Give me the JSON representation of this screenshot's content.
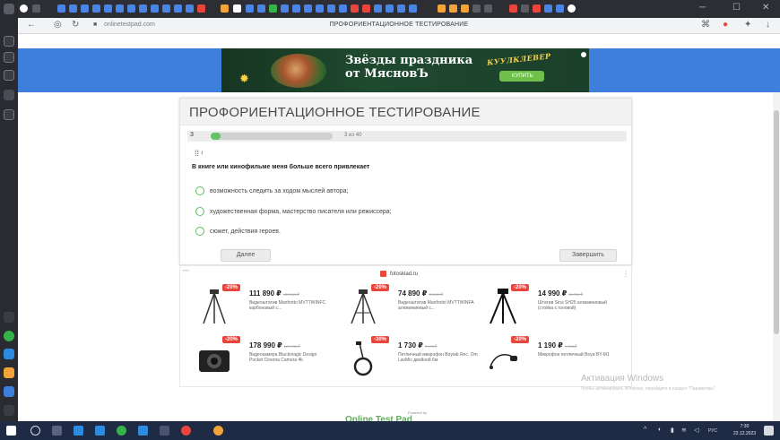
{
  "browser": {
    "url": "onlinetestpad.com",
    "tab_title": "ПРОФОРИЕНТАЦИОННОЕ ТЕСТИРОВАНИЕ",
    "window_controls": [
      "─",
      "☐",
      "✕"
    ]
  },
  "banner": {
    "headline_line1": "Звёзды праздника",
    "headline_line2": "от МясновЪ",
    "brand": "КУУЛКЛЕВЕР",
    "buy_label": "КУПИТЬ"
  },
  "test": {
    "title": "ПРОФОРИЕНТАЦИОННОЕ ТЕСТИРОВАНИЕ",
    "question_number": "3",
    "progress_fraction": 0.05,
    "progress_label": "3 из 40",
    "question": "В книге или кинофильме меня больше всего привлекает",
    "options": [
      "возможность следить за ходом мыслей автора;",
      "художественная форма, мастерство писателя или режиссера;",
      "сюжет, действия героев."
    ],
    "next_label": "Далее",
    "finish_label": "Завершить"
  },
  "ads": {
    "shop_name": "fotosklad.ru",
    "products": [
      {
        "discount": "-20%",
        "price": "111 890 ₽",
        "old_price": "139 863 ₽",
        "desc": "Видеоштатив Manfrotto MVTTWINFC карбоновый с..."
      },
      {
        "discount": "-20%",
        "price": "74 890 ₽",
        "old_price": "93 613 ₽",
        "desc": "Видеоштатив Manfrotto MVTTWINFA алюминиевый с..."
      },
      {
        "discount": "-20%",
        "price": "14 990 ₽",
        "old_price": "18 738 ₽",
        "desc": "Штатив Sirui SH25 алюминиевый (стойка с головой)"
      },
      {
        "discount": "-20%",
        "price": "178 990 ₽",
        "old_price": "223 738 ₽",
        "desc": "Видеокамера Blackmagic Design Pocket Cinema Camera 4k"
      },
      {
        "discount": "-30%",
        "price": "1 730 ₽",
        "old_price": "2 470 ₽",
        "desc": "Петличный микрофон Boyiab Rec. Om LavMic двойной 6м"
      },
      {
        "discount": "-20%",
        "price": "1 190 ₽",
        "old_price": "1 488 ₽",
        "desc": "Микрофон петличный Boya BY-M1"
      }
    ]
  },
  "footer": {
    "powered": "Powered by",
    "logo_text": "Online Test Pad"
  },
  "watermark": {
    "title": "Активация Windows",
    "subtitle": "Чтобы активировать Windows, перейдите в раздел \"Параметры\"."
  },
  "taskbar": {
    "time": "7:30",
    "date": "22.12.2023",
    "lang": "РУС"
  },
  "colors": {
    "banner_band": "#3f7fdc",
    "progress_fill": "#62c462",
    "discount": "#e8453c",
    "taskbar": "#1f2a44"
  }
}
